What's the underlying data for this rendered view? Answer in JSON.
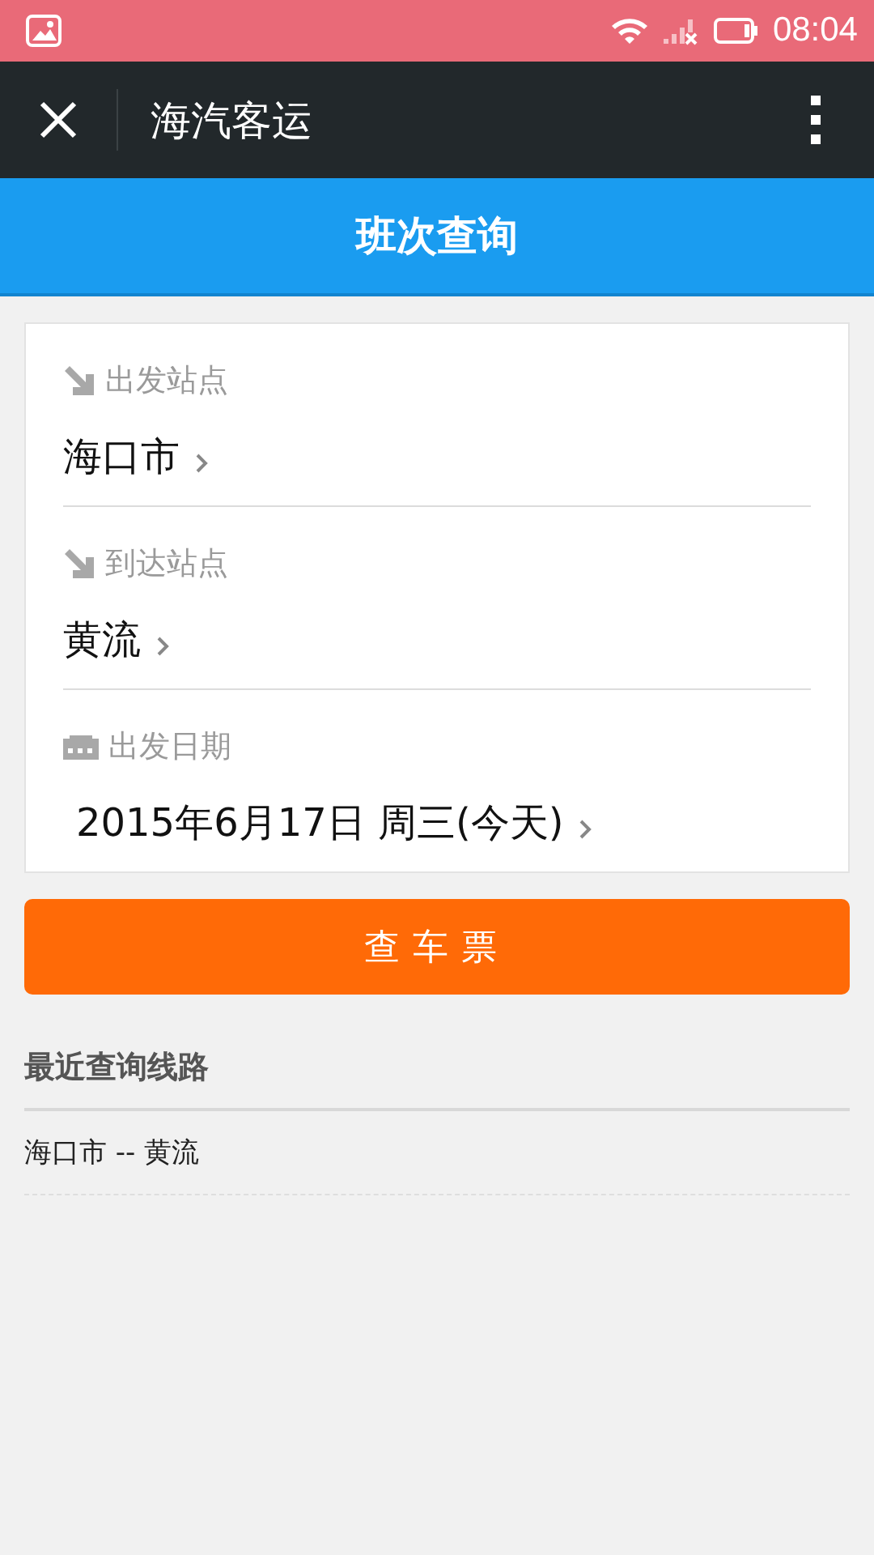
{
  "status_bar": {
    "time": "08:04"
  },
  "app_bar": {
    "title": "海汽客运"
  },
  "header": {
    "title": "班次查询"
  },
  "form": {
    "fields": [
      {
        "kind": "station",
        "label": "出发站点",
        "value": "海口市"
      },
      {
        "kind": "station",
        "label": "到达站点",
        "value": "黄流"
      },
      {
        "kind": "date",
        "label": "出发日期",
        "value": "2015年6月17日 周三(今天)"
      }
    ]
  },
  "search_button": {
    "label": "查车票"
  },
  "recent": {
    "title": "最近查询线路",
    "items": [
      "海口市 -- 黄流"
    ]
  }
}
